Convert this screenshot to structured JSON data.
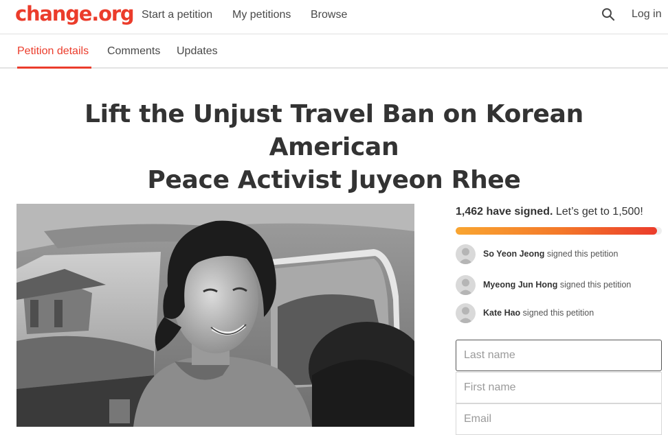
{
  "brand": {
    "logo_text": "change.org",
    "accent": "#eb3c2b"
  },
  "nav": {
    "items": [
      {
        "label": "Start a petition"
      },
      {
        "label": "My petitions"
      },
      {
        "label": "Browse"
      }
    ],
    "search_icon": "search-icon",
    "login_label": "Log in"
  },
  "tabs": [
    {
      "label": "Petition details",
      "active": true
    },
    {
      "label": "Comments",
      "active": false
    },
    {
      "label": "Updates",
      "active": false
    }
  ],
  "petition": {
    "title_line1": "Lift the Unjust Travel Ban on Korean American",
    "title_line2": "Peace Activist Juyeon Rhee"
  },
  "signatures": {
    "count_text": "1,462 have signed.",
    "goal_text": "Let’s get to 1,500!",
    "progress_fraction": 0.975
  },
  "recent_signers": [
    {
      "name": "So Yeon Jeong",
      "action": "signed this petition"
    },
    {
      "name": "Myeong Jun Hong",
      "action": "signed this petition"
    },
    {
      "name": "Kate Hao",
      "action": "signed this petition"
    }
  ],
  "form": {
    "last_name_placeholder": "Last name",
    "first_name_placeholder": "First name",
    "email_placeholder": "Email"
  }
}
